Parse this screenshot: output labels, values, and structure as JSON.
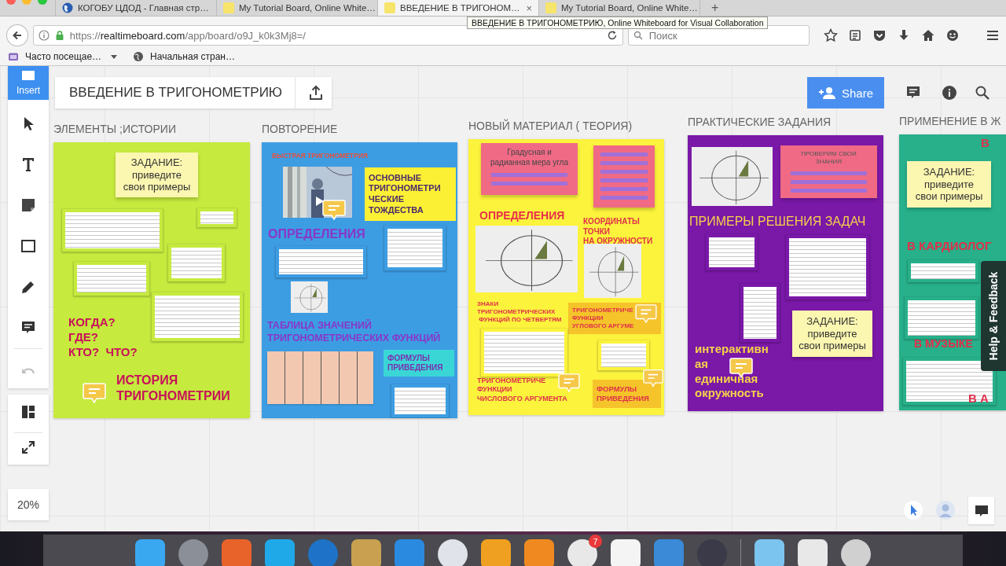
{
  "browser": {
    "tabs": [
      {
        "title": "КОГОБУ ЦДОД - Главная стр…",
        "kind": "globe",
        "selected": false
      },
      {
        "title": "My Tutorial Board, Online White…",
        "kind": "board",
        "selected": false
      },
      {
        "title": "ВВЕДЕНИЕ В ТРИГОНОМ…",
        "kind": "board",
        "selected": true
      },
      {
        "title": "My Tutorial Board, Online White…",
        "kind": "board",
        "selected": false
      }
    ],
    "close_mark": "×",
    "new_tab": "+",
    "tooltip": "ВВЕДЕНИЕ В ТРИГОНОМЕТРИЮ, Online Whiteboard for Visual Collaboration",
    "url": {
      "scheme": "https://",
      "host": "realtimeboard.com",
      "path": "/app/board/o9J_k0k3Mj8=/"
    },
    "search": {
      "placeholder": "Поиск"
    },
    "bookmarks": [
      {
        "label": "Часто посещае…",
        "kind": "folder"
      },
      {
        "label": "Начальная стран…",
        "kind": "page"
      }
    ]
  },
  "board": {
    "title": "ВВЕДЕНИЕ В ТРИГОНОМЕТРИЮ",
    "insert": "Insert",
    "share": "Share",
    "zoom": "20%",
    "undo": {
      "disabled": true
    },
    "help": "Help & Feedback",
    "frames": [
      {
        "title": "ЭЛЕМЕНТЫ ;ИСТОРИИ",
        "color": "#c6ea3e",
        "items": [
          {
            "kind": "sticky",
            "text": "ЗАДАНИЕ:\nприведите\nсвои примеры",
            "color": "#fbf6b0"
          },
          {
            "kind": "doc"
          },
          {
            "kind": "doc"
          },
          {
            "kind": "doc"
          },
          {
            "kind": "doc"
          },
          {
            "kind": "doc"
          },
          {
            "kind": "heading",
            "text": "КОГДА?\nГДЕ?\nКТО?  ЧТО?",
            "color": "#c8105a"
          },
          {
            "kind": "heading",
            "text": "ИСТОРИЯ\nТРИГОНОМЕТРИИ",
            "color": "#c8105a"
          },
          {
            "kind": "comment"
          }
        ]
      },
      {
        "title": "ПОВТОРЕНИЕ",
        "color": "#3d9de3",
        "items": [
          {
            "kind": "heading",
            "text": "БЫСТРАЯ ТРИГОНОМЕТРИЯ",
            "color": "#e8503a"
          },
          {
            "kind": "video"
          },
          {
            "kind": "note",
            "text": "ОСНОВНЫЕ\nТРИГОНОМЕТРИ\nЧЕСКИЕ\nТОЖДЕСТВА",
            "color": "#fcf035"
          },
          {
            "kind": "comment"
          },
          {
            "kind": "heading",
            "text": "ОПРЕДЕЛЕНИЯ",
            "color": "#8a36c8"
          },
          {
            "kind": "doc"
          },
          {
            "kind": "doc"
          },
          {
            "kind": "diagram"
          },
          {
            "kind": "heading",
            "text": "ТАБЛИЦА ЗНАЧЕНИЙ\nТРИГОНОМЕТРИЧЕСКИХ ФУНКЦИЙ",
            "color": "#8a36c8"
          },
          {
            "kind": "table"
          },
          {
            "kind": "note",
            "text": "ФОРМУЛЫ\nПРИВЕДЕНИЯ",
            "color": "#3ad6d6"
          },
          {
            "kind": "doc"
          }
        ]
      },
      {
        "title": "НОВЫЙ МАТЕРИАЛ ( ТЕОРИЯ)",
        "color": "#fbf33c",
        "items": [
          {
            "kind": "link-note",
            "text": "Градусная и\nрадианная мера угла",
            "color": "#f06a85"
          },
          {
            "kind": "link-note",
            "color": "#f06a85"
          },
          {
            "kind": "heading",
            "text": "ОПРЕДЕЛЕНИЯ",
            "color": "#e8304a"
          },
          {
            "kind": "heading",
            "text": "КООРДИНАТЫ\nТОЧКИ\nНА ОКРУЖНОСТИ",
            "color": "#e0304a"
          },
          {
            "kind": "diagram"
          },
          {
            "kind": "diagram"
          },
          {
            "kind": "heading",
            "text": "ЗНАКИ\nТРИГОНОМЕТРИЧЕСКИХ\n ФУНКЦИЙ ПО ЧЕТВЕРТЯМ",
            "color": "#e0304a"
          },
          {
            "kind": "note",
            "text": "ТРИГОНОМЕТРИЧЕ\nФУНКЦИИ\nУГЛОВОГО АРГУМЕ",
            "color": "#f5c32a"
          },
          {
            "kind": "doc"
          },
          {
            "kind": "doc"
          },
          {
            "kind": "heading",
            "text": "ТРИГОНОМЕТРИЧЕ\nФУНКЦИИ\nЧИСЛОВОГО АРГУМЕНТА",
            "color": "#e0304a"
          },
          {
            "kind": "note",
            "text": "ФОРМУЛЫ\nПРИВЕДЕНИЯ",
            "color": "#f5c32a"
          },
          {
            "kind": "comment"
          },
          {
            "kind": "comment"
          },
          {
            "kind": "comment"
          }
        ]
      },
      {
        "title": "ПРАКТИЧЕСКИЕ ЗАДАНИЯ",
        "color": "#7a18a8",
        "items": [
          {
            "kind": "diagram"
          },
          {
            "kind": "link-note",
            "text": "ПРОВЕРИМ СВОИ\nЗНАНИЯ",
            "color": "#f06a85"
          },
          {
            "kind": "heading",
            "text": "ПРИМЕРЫ РЕШЕНИЯ ЗАДАЧ",
            "color": "#f5d24a"
          },
          {
            "kind": "doc"
          },
          {
            "kind": "doc"
          },
          {
            "kind": "doc"
          },
          {
            "kind": "sticky",
            "text": "ЗАДАНИЕ:\nприведите\nсвои примеры",
            "color": "#fbf6b0"
          },
          {
            "kind": "heading",
            "text": "интерактивн\nая\nединичная\nокружность",
            "color": "#f5d24a"
          },
          {
            "kind": "comment"
          }
        ]
      },
      {
        "title": "ПРИМЕНЕНИЕ В Ж",
        "color": "#27b08a",
        "items": [
          {
            "kind": "heading",
            "text": "В",
            "color": "#e0304a"
          },
          {
            "kind": "sticky",
            "text": "ЗАДАНИЕ:\nприведите\nсвои примеры",
            "color": "#fbf6b0"
          },
          {
            "kind": "heading",
            "text": "В КАРДИОЛОГ",
            "color": "#e0304a"
          },
          {
            "kind": "doc"
          },
          {
            "kind": "doc"
          },
          {
            "kind": "heading",
            "text": "В МУЗЫКЕ",
            "color": "#e0304a"
          },
          {
            "kind": "doc"
          },
          {
            "kind": "heading",
            "text": "В А",
            "color": "#e0304a"
          }
        ]
      }
    ]
  },
  "dock": {
    "badge": "7"
  }
}
